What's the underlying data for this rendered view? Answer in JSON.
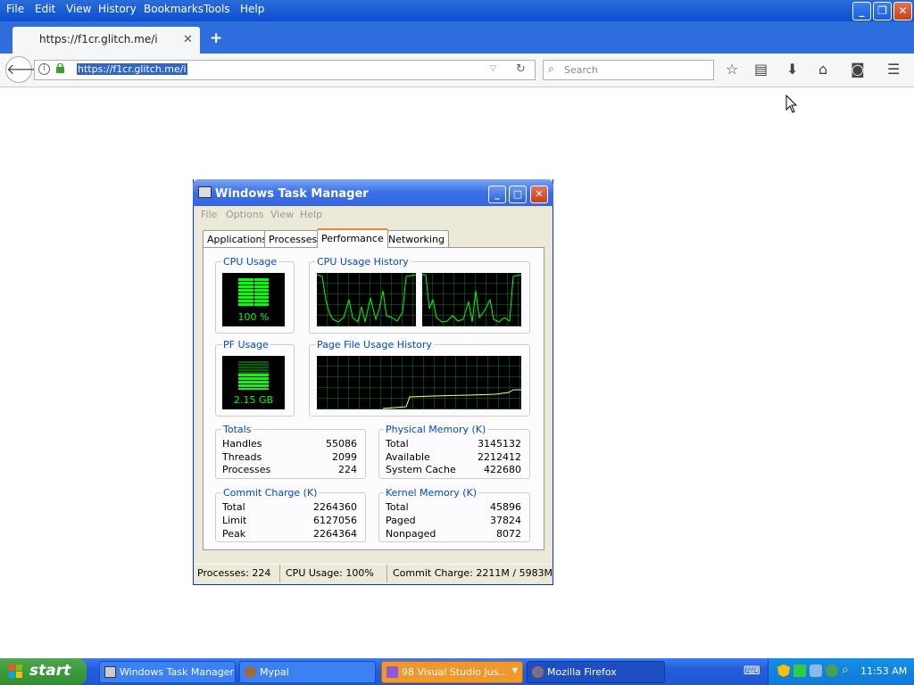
{
  "firefox": {
    "menu": [
      "File",
      "Edit",
      "View",
      "History",
      "Bookmarks",
      "Tools",
      "Help"
    ],
    "tab_title": "https://f1cr.glitch.me/i",
    "url": "https://f1cr.glitch.me/i",
    "search_placeholder": "Search"
  },
  "task_manager": {
    "title": "Windows Task Manager",
    "menu": [
      "File",
      "Options",
      "View",
      "Help"
    ],
    "tabs": [
      "Applications",
      "Processes",
      "Performance",
      "Networking"
    ],
    "active_tab": "Performance",
    "cpu_usage_label": "CPU Usage",
    "cpu_usage_value": "100 %",
    "cpu_history_label": "CPU Usage History",
    "pf_usage_label": "PF Usage",
    "pf_usage_value": "2.15 GB",
    "pf_history_label": "Page File Usage History",
    "totals": {
      "label": "Totals",
      "rows": [
        [
          "Handles",
          "55086"
        ],
        [
          "Threads",
          "2099"
        ],
        [
          "Processes",
          "224"
        ]
      ]
    },
    "physical_memory": {
      "label": "Physical Memory (K)",
      "rows": [
        [
          "Total",
          "3145132"
        ],
        [
          "Available",
          "2212412"
        ],
        [
          "System Cache",
          "422680"
        ]
      ]
    },
    "commit_charge": {
      "label": "Commit Charge (K)",
      "rows": [
        [
          "Total",
          "2264360"
        ],
        [
          "Limit",
          "6127056"
        ],
        [
          "Peak",
          "2264364"
        ]
      ]
    },
    "kernel_memory": {
      "label": "Kernel Memory (K)",
      "rows": [
        [
          "Total",
          "45896"
        ],
        [
          "Paged",
          "37824"
        ],
        [
          "Nonpaged",
          "8072"
        ]
      ]
    },
    "status": {
      "processes": "Processes: 224",
      "cpu": "CPU Usage: 100%",
      "commit": "Commit Charge: 2211M / 5983M"
    }
  },
  "taskbar": {
    "start": "start",
    "tasks": [
      "Windows Task Manager",
      "Mypal",
      "98 Visual Studio Jus...",
      "Mozilla Firefox"
    ],
    "clock": "11:53 AM"
  },
  "colors": {
    "accent": "#0046d5",
    "graph_green": "#00ff00",
    "graph_yellow": "#ffff80"
  }
}
